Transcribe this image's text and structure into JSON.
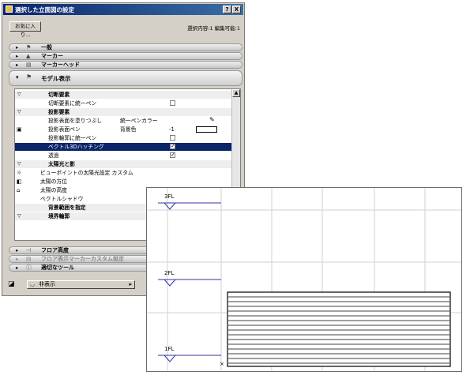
{
  "dialog": {
    "title": "選択した立面図の設定",
    "help_label": "?",
    "close_label": "X",
    "favorites_label": "お気に入り...",
    "selection_status": "選択内容:1 編集可能:1"
  },
  "panels_top": [
    {
      "arrow": "▸",
      "icon": "general-icon",
      "glyph": "⚑",
      "label": "一般"
    },
    {
      "arrow": "▸",
      "icon": "marker-icon",
      "glyph": "▲",
      "label": "マーカー"
    },
    {
      "arrow": "▸",
      "icon": "marker-head-icon",
      "glyph": "▤",
      "label": "マーカーヘッド"
    }
  ],
  "open_panel": {
    "arrow": "▾",
    "glyph": "⚑",
    "label": "モデル表示"
  },
  "settings_rows": [
    {
      "kind": "group",
      "tri": "▽",
      "label": "切断要素"
    },
    {
      "kind": "item",
      "label": "切断要素に統一ペン",
      "checkbox": false
    },
    {
      "kind": "group",
      "tri": "▽",
      "label": "投影要素"
    },
    {
      "kind": "item",
      "label": "投影表面を塗りつぶし",
      "value": "統一ペンカラー",
      "pen_icon": "✎"
    },
    {
      "kind": "item",
      "icon": "▣",
      "label": "投影表面ペン",
      "value": "背景色",
      "num": "-1",
      "swatch": true
    },
    {
      "kind": "item",
      "label": "投影輪郭に統一ペン",
      "checkbox": false
    },
    {
      "kind": "item",
      "label": "ベクトル3Dハッチング",
      "checkbox": true,
      "selected": true
    },
    {
      "kind": "item",
      "label": "透過",
      "checkbox": true
    },
    {
      "kind": "group",
      "tri": "▽",
      "label": "太陽光と影"
    },
    {
      "kind": "item",
      "icon": "☼",
      "label": "ビューポイントの太陽光設定 カスタム"
    },
    {
      "kind": "item",
      "icon": "◧",
      "label": "太陽の方位"
    },
    {
      "kind": "item",
      "icon": "⌂",
      "label": "太陽の高度"
    },
    {
      "kind": "item",
      "label": "ベクトルシャドウ"
    },
    {
      "kind": "item",
      "label": "背景範囲を指定",
      "bold": true
    },
    {
      "kind": "group",
      "tri": "▽",
      "label": "境界輪郭"
    }
  ],
  "panels_bottom": [
    {
      "arrow": "▸",
      "icon": "floor-height-icon",
      "glyph": "⊣",
      "label": "フロア高度",
      "disabled": false
    },
    {
      "arrow": "▸",
      "icon": "floor-marker-icon",
      "glyph": "▤",
      "label": "フロア表示マーカーカスタム設定",
      "disabled": true
    },
    {
      "arrow": "▸",
      "icon": "tool-icon",
      "glyph": "ⓘ",
      "label": "適切なツール",
      "disabled": false
    }
  ],
  "bottom_bar": {
    "layer_glyph": "◪",
    "dropdown_label": "非表示",
    "dropdown_arrow": "▸"
  },
  "drawing": {
    "levels": [
      "3FL",
      "2FL",
      "1FL"
    ],
    "colors": {
      "level_line": "#3333aa",
      "grid": "#d0d0d0"
    }
  }
}
